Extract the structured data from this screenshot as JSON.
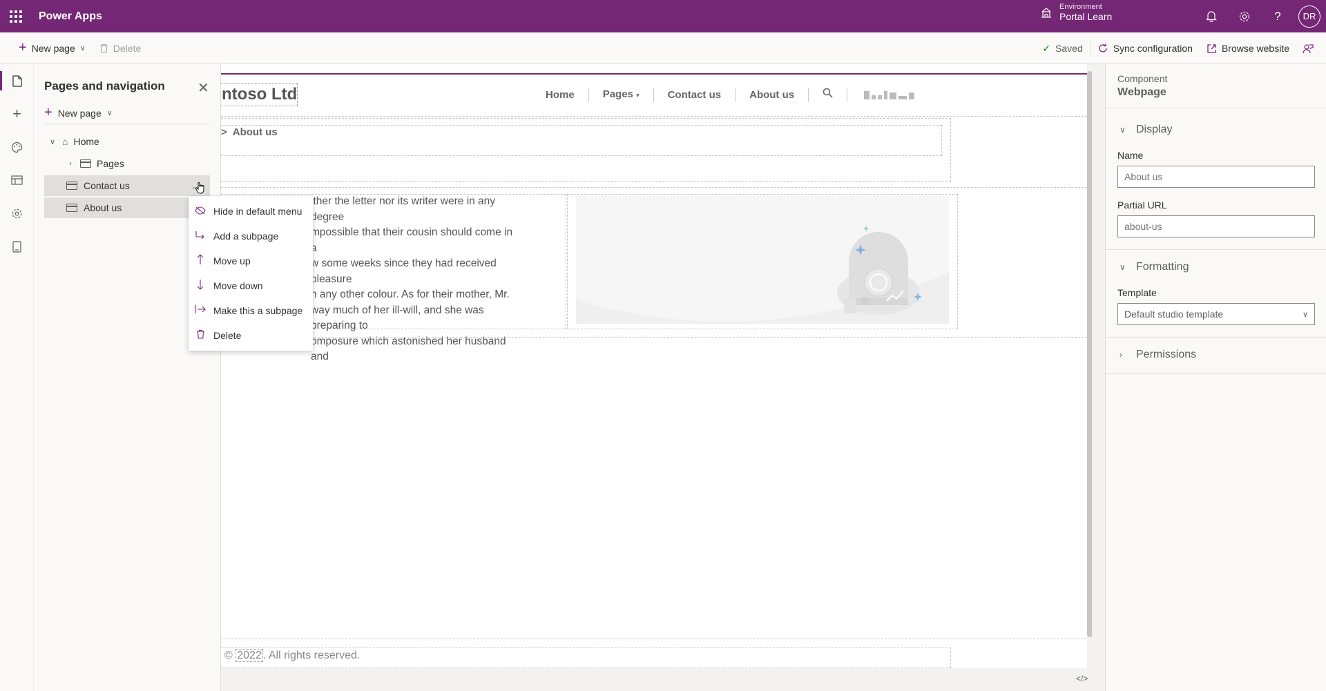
{
  "app": {
    "title": "Power Apps"
  },
  "environment": {
    "label": "Environment",
    "name": "Portal Learn"
  },
  "user": {
    "initials": "DR"
  },
  "toolbar": {
    "new_page": "New page",
    "delete": "Delete",
    "saved": "Saved",
    "sync": "Sync configuration",
    "browse": "Browse website"
  },
  "pages_panel": {
    "title": "Pages and navigation",
    "new_page": "New page",
    "tree": [
      {
        "label": "Home"
      },
      {
        "label": "Pages"
      },
      {
        "label": "Contact us"
      },
      {
        "label": "About us"
      }
    ]
  },
  "context_menu": {
    "items": [
      {
        "label": "Hide in default menu",
        "icon": "eye-off-icon"
      },
      {
        "label": "Add a subpage",
        "icon": "subpage-icon"
      },
      {
        "label": "Move up",
        "icon": "arrow-up-icon"
      },
      {
        "label": "Move down",
        "icon": "arrow-down-icon"
      },
      {
        "label": "Make this a subpage",
        "icon": "indent-icon"
      },
      {
        "label": "Delete",
        "icon": "trash-icon"
      }
    ]
  },
  "site": {
    "brand": "ntoso Ltd",
    "nav": [
      "Home",
      "Pages",
      "Contact us",
      "About us"
    ],
    "breadcrumb": "About us",
    "breadcrumb_sep": ">",
    "body_lines": [
      "ither the letter nor its writer were in any degree",
      "mpossible that their cousin should come in a",
      "w some weeks since they had received pleasure",
      "n any other colour. As for their mother, Mr.",
      "way much of her ill-will, and she was preparing to",
      "omposure which astonished her husband and"
    ],
    "footer_year": "2022",
    "footer_prefix": "©",
    "footer_rest": ". All rights reserved."
  },
  "properties": {
    "component_label": "Component",
    "component_value": "Webpage",
    "display_section": "Display",
    "name_label": "Name",
    "name_placeholder": "About us",
    "url_label": "Partial URL",
    "url_placeholder": "about-us",
    "formatting_section": "Formatting",
    "template_label": "Template",
    "template_value": "Default studio template",
    "permissions_section": "Permissions"
  },
  "colors": {
    "brand": "#742774",
    "canvas": "#ffffff",
    "panel": "#faf9f8"
  }
}
